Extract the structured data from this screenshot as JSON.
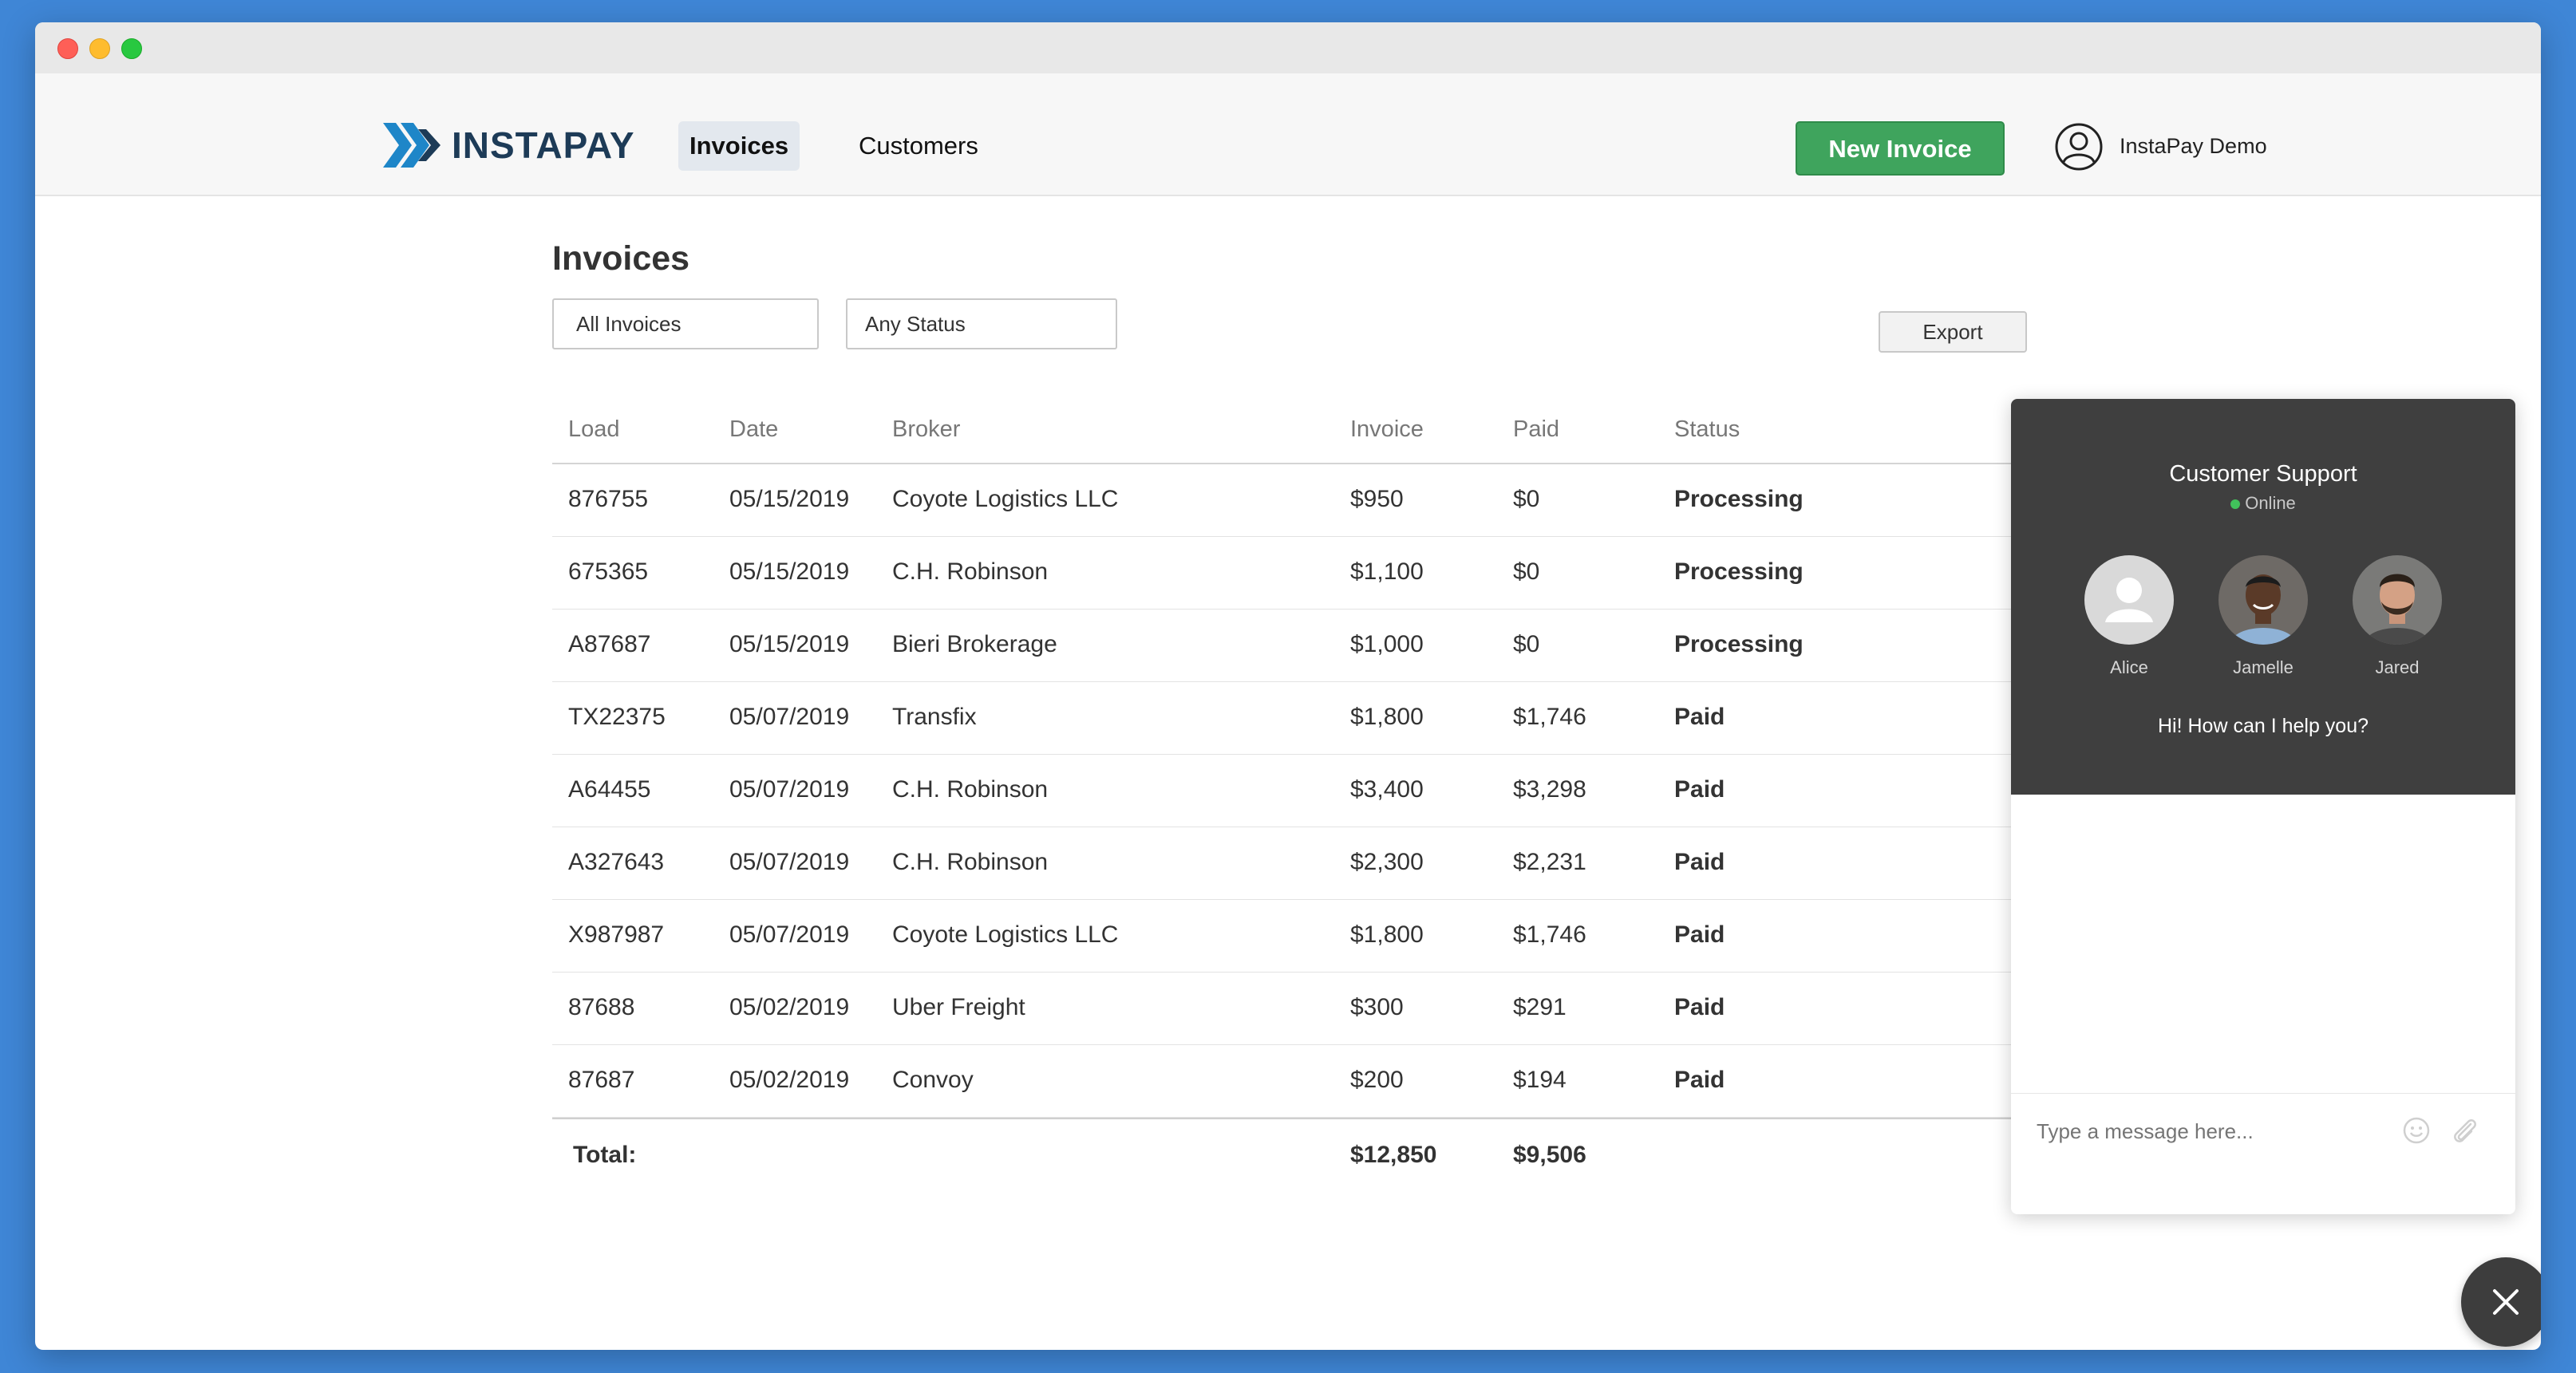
{
  "app": {
    "name": "INSTAPAY"
  },
  "nav": {
    "items": [
      {
        "label": "Invoices",
        "active": true
      },
      {
        "label": "Customers",
        "active": false
      }
    ],
    "new_invoice_label": "New Invoice",
    "user_name": "InstaPay Demo"
  },
  "page": {
    "title": "Invoices",
    "filters": {
      "invoice_filter": "All Invoices",
      "status_filter": "Any Status"
    },
    "export_label": "Export"
  },
  "table": {
    "headers": [
      "Load",
      "Date",
      "Broker",
      "Invoice",
      "Paid",
      "Status"
    ],
    "rows": [
      {
        "load": "876755",
        "date": "05/15/2019",
        "broker": "Coyote Logistics LLC",
        "invoice": "$950",
        "paid": "$0",
        "status": "Processing"
      },
      {
        "load": "675365",
        "date": "05/15/2019",
        "broker": "C.H. Robinson",
        "invoice": "$1,100",
        "paid": "$0",
        "status": "Processing"
      },
      {
        "load": "A87687",
        "date": "05/15/2019",
        "broker": "Bieri Brokerage",
        "invoice": "$1,000",
        "paid": "$0",
        "status": "Processing"
      },
      {
        "load": "TX22375",
        "date": "05/07/2019",
        "broker": "Transfix",
        "invoice": "$1,800",
        "paid": "$1,746",
        "status": "Paid"
      },
      {
        "load": "A64455",
        "date": "05/07/2019",
        "broker": "C.H. Robinson",
        "invoice": "$3,400",
        "paid": "$3,298",
        "status": "Paid"
      },
      {
        "load": "A327643",
        "date": "05/07/2019",
        "broker": "C.H. Robinson",
        "invoice": "$2,300",
        "paid": "$2,231",
        "status": "Paid"
      },
      {
        "load": "X987987",
        "date": "05/07/2019",
        "broker": "Coyote Logistics LLC",
        "invoice": "$1,800",
        "paid": "$1,746",
        "status": "Paid"
      },
      {
        "load": "87688",
        "date": "05/02/2019",
        "broker": "Uber Freight",
        "invoice": "$300",
        "paid": "$291",
        "status": "Paid"
      },
      {
        "load": "87687",
        "date": "05/02/2019",
        "broker": "Convoy",
        "invoice": "$200",
        "paid": "$194",
        "status": "Paid"
      }
    ],
    "total": {
      "label": "Total:",
      "invoice": "$12,850",
      "paid": "$9,506"
    }
  },
  "chat": {
    "title": "Customer Support",
    "status": "Online",
    "agents": [
      "Alice",
      "Jamelle",
      "Jared"
    ],
    "greeting": "Hi! How can I help you?",
    "input_placeholder": "Type a message here..."
  },
  "colors": {
    "brand": "#1d3b57",
    "accent_green": "#3fa45d",
    "processing": "#1e86c8",
    "paid": "#2e8b4f",
    "chat_header": "#3f3f3f",
    "desktop_bg": "#3f86d6"
  },
  "icons": {
    "logo": "chevron-arrows-icon",
    "user": "user-circle-icon",
    "emoji": "smiley-icon",
    "attach": "paperclip-icon",
    "close": "close-icon"
  }
}
